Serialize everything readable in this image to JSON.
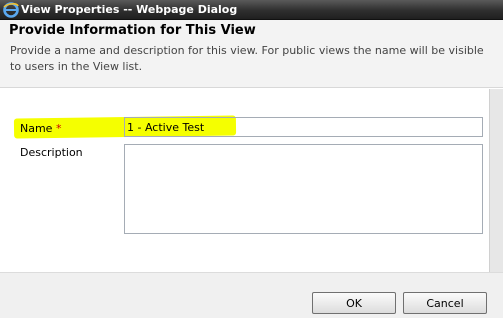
{
  "window": {
    "title": "View Properties -- Webpage Dialog",
    "icon": "internet-explorer-icon"
  },
  "header": {
    "title": "Provide Information for This View",
    "description": "Provide a name and description for this view. For public views the name will be visible to users in the View list."
  },
  "form": {
    "name_label": "Name",
    "required_marker": "*",
    "name_value": "1 - Active Test",
    "description_label": "Description",
    "description_value": ""
  },
  "footer": {
    "ok_label": "OK",
    "cancel_label": "Cancel"
  },
  "colors": {
    "highlight": "#f5ff00",
    "required": "#cc0000",
    "titlebar": "#2f2f2f"
  }
}
